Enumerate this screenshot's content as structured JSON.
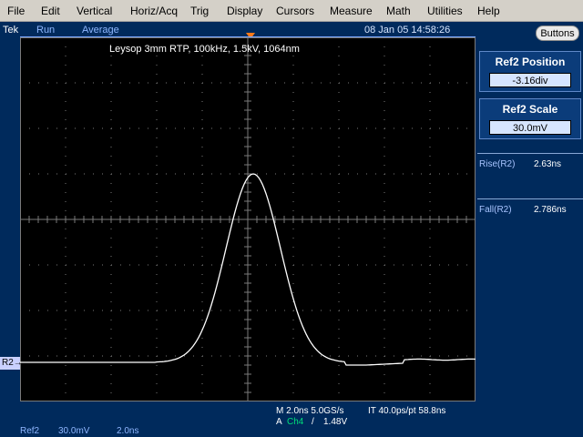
{
  "menu": [
    "File",
    "Edit",
    "Vertical",
    "Horiz/Acq",
    "Trig",
    "Display",
    "Cursors",
    "Measure",
    "Math",
    "Utilities",
    "Help"
  ],
  "status": {
    "brand": "Tek",
    "run": "Run",
    "acq": "Average",
    "timestamp": "08 Jan 05 14:58:26",
    "buttons": "Buttons"
  },
  "screen": {
    "label": "Leysop 3mm RTP, 100kHz, 1.5kV, 1064nm",
    "ref_marker": "R2"
  },
  "panel": {
    "ref2_position": {
      "title": "Ref2 Position",
      "value": "-3.16div"
    },
    "ref2_scale": {
      "title": "Ref2 Scale",
      "value": "30.0mV"
    },
    "measurements": [
      {
        "label": "Rise(R2)",
        "value": "2.63ns"
      },
      {
        "label": "Fall(R2)",
        "value": "2.786ns"
      }
    ]
  },
  "bottom": {
    "horiz": "M 2.0ns 5.0GS/s",
    "interp": "IT 40.0ps/pt 58.8ns",
    "trig_prefix": "A",
    "trig_src": "Ch4",
    "trig_slope": "/",
    "trig_level": "1.48V",
    "ref_name": "Ref2",
    "ref_scale": "30.0mV",
    "ref_time": "2.0ns"
  },
  "colors": {
    "trace": "#ffffff",
    "grid": "#7a7a7a",
    "screen_bg": "#000000",
    "accent": "#ff7a1a"
  }
}
